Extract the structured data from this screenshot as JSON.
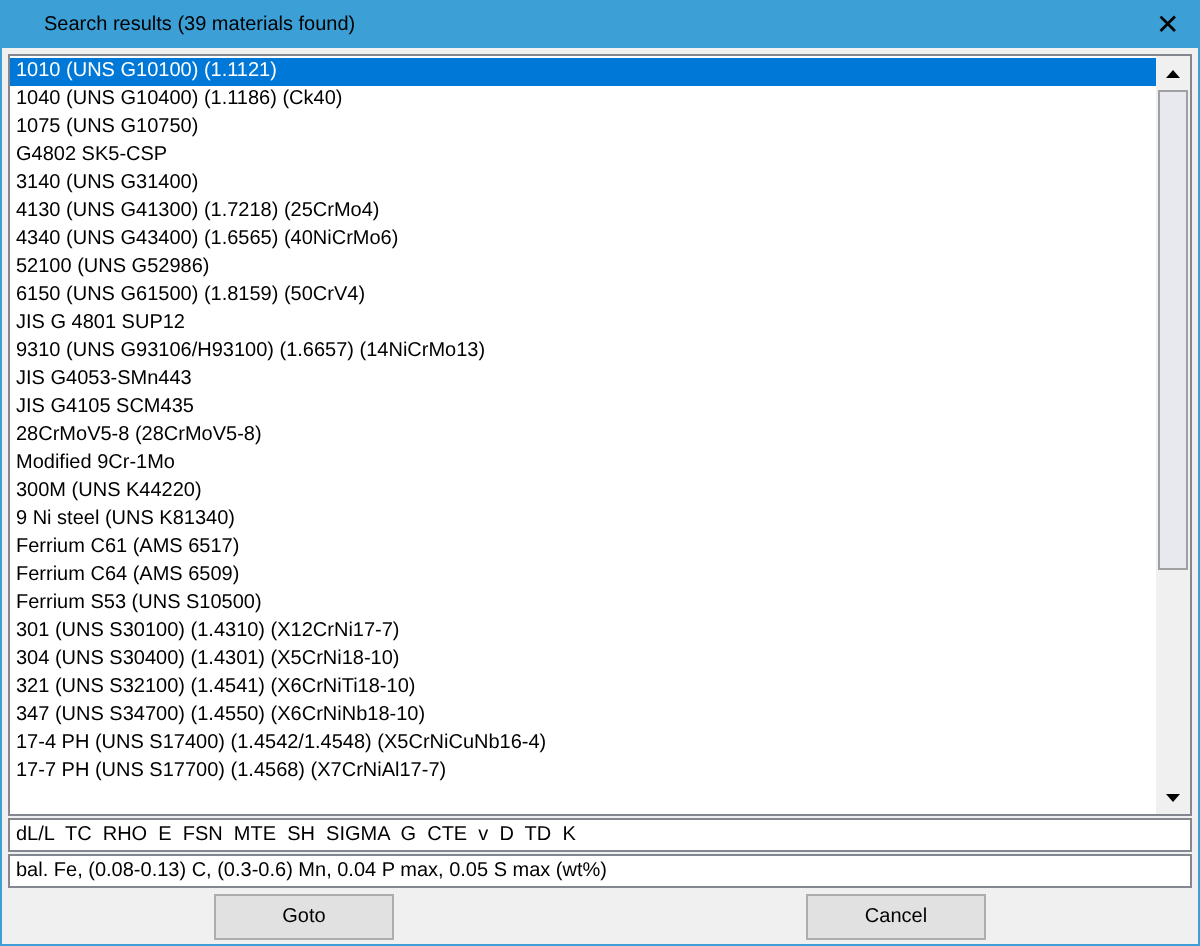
{
  "window": {
    "title": "Search results (39 materials found)",
    "close": "✕"
  },
  "results": [
    {
      "label": "1010 (UNS G10100) (1.1121)",
      "selected": true
    },
    {
      "label": "1040 (UNS G10400) (1.1186) (Ck40)",
      "selected": false
    },
    {
      "label": "1075 (UNS G10750)",
      "selected": false
    },
    {
      "label": "G4802 SK5-CSP",
      "selected": false
    },
    {
      "label": "3140 (UNS G31400)",
      "selected": false
    },
    {
      "label": "4130 (UNS G41300) (1.7218) (25CrMo4)",
      "selected": false
    },
    {
      "label": "4340 (UNS G43400) (1.6565) (40NiCrMo6)",
      "selected": false
    },
    {
      "label": "52100 (UNS G52986)",
      "selected": false
    },
    {
      "label": "6150 (UNS G61500) (1.8159) (50CrV4)",
      "selected": false
    },
    {
      "label": "JIS G 4801 SUP12",
      "selected": false
    },
    {
      "label": "9310 (UNS G93106/H93100) (1.6657) (14NiCrMo13)",
      "selected": false
    },
    {
      "label": "JIS G4053-SMn443",
      "selected": false
    },
    {
      "label": "JIS G4105 SCM435",
      "selected": false
    },
    {
      "label": "28CrMoV5-8 (28CrMoV5-8)",
      "selected": false
    },
    {
      "label": "Modified 9Cr-1Mo",
      "selected": false
    },
    {
      "label": "300M (UNS K44220)",
      "selected": false
    },
    {
      "label": "9 Ni steel (UNS K81340)",
      "selected": false
    },
    {
      "label": "Ferrium C61 (AMS 6517)",
      "selected": false
    },
    {
      "label": "Ferrium C64 (AMS 6509)",
      "selected": false
    },
    {
      "label": "Ferrium S53 (UNS S10500)",
      "selected": false
    },
    {
      "label": "301 (UNS S30100) (1.4310) (X12CrNi17-7)",
      "selected": false
    },
    {
      "label": "304 (UNS S30400) (1.4301) (X5CrNi18-10)",
      "selected": false
    },
    {
      "label": "321 (UNS S32100) (1.4541) (X6CrNiTi18-10)",
      "selected": false
    },
    {
      "label": "347 (UNS S34700) (1.4550) (X6CrNiNb18-10)",
      "selected": false
    },
    {
      "label": "17-4 PH (UNS S17400) (1.4542/1.4548) (X5CrNiCuNb16-4)",
      "selected": false
    },
    {
      "label": "17-7 PH (UNS S17700) (1.4568) (X7CrNiAl17-7)",
      "selected": false
    }
  ],
  "properties": "dL/L  TC  RHO  E  FSN  MTE  SH  SIGMA  G  CTE  v  D  TD  K",
  "composition": "bal. Fe, (0.08-0.13) C, (0.3-0.6) Mn, 0.04 P max, 0.05 S max (wt%)",
  "buttons": [
    "Goto",
    "Cancel"
  ]
}
